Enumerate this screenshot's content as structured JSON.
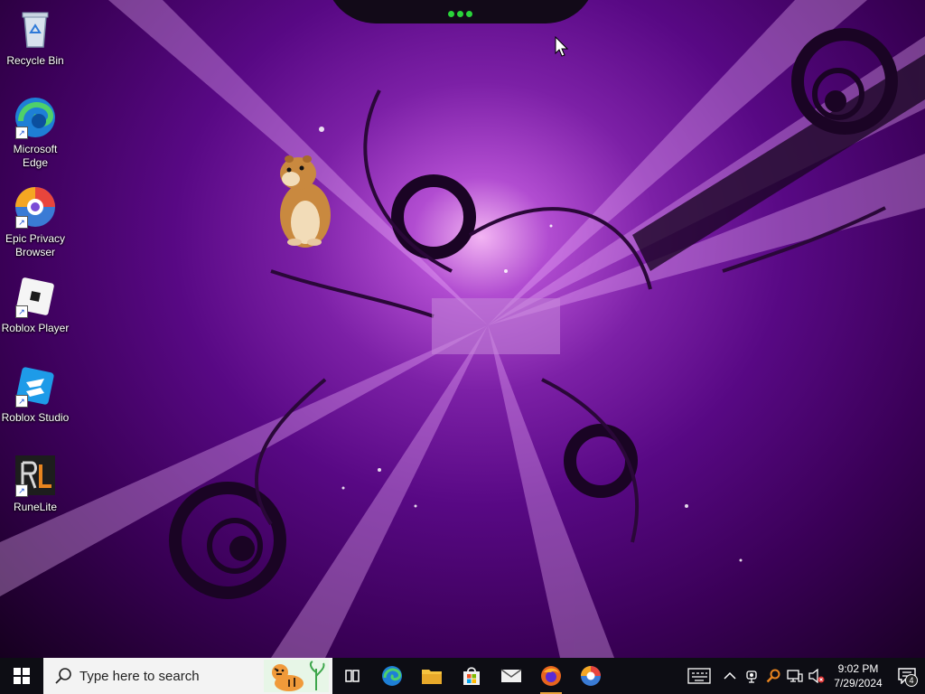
{
  "desktop": {
    "icons": [
      {
        "label": "Recycle Bin",
        "icon": "recycle-bin-icon"
      },
      {
        "label": "Microsoft Edge",
        "icon": "edge-icon"
      },
      {
        "label": "Epic Privacy Browser",
        "icon": "epic-browser-icon"
      },
      {
        "label": "Roblox Player",
        "icon": "roblox-icon"
      },
      {
        "label": "Roblox Studio",
        "icon": "roblox-studio-icon"
      },
      {
        "label": "RuneLite",
        "icon": "runelite-icon"
      }
    ]
  },
  "taskbar": {
    "search_placeholder": "Type here to search",
    "apps": [
      {
        "name": "Task View",
        "icon": "task-view-icon"
      },
      {
        "name": "Microsoft Edge",
        "icon": "edge-icon"
      },
      {
        "name": "File Explorer",
        "icon": "folder-icon"
      },
      {
        "name": "Microsoft Store",
        "icon": "store-icon"
      },
      {
        "name": "Mail",
        "icon": "mail-icon"
      },
      {
        "name": "Firefox",
        "icon": "firefox-icon"
      },
      {
        "name": "Epic Privacy Browser",
        "icon": "epic-browser-icon"
      }
    ],
    "clock": {
      "time": "9:02 PM",
      "date": "7/29/2024"
    },
    "notification_count": "4"
  },
  "colors": {
    "taskbar_bg": "#0d0d14",
    "wallpaper_accent": "#b040e0",
    "running_indicator": "#e9a23b"
  }
}
